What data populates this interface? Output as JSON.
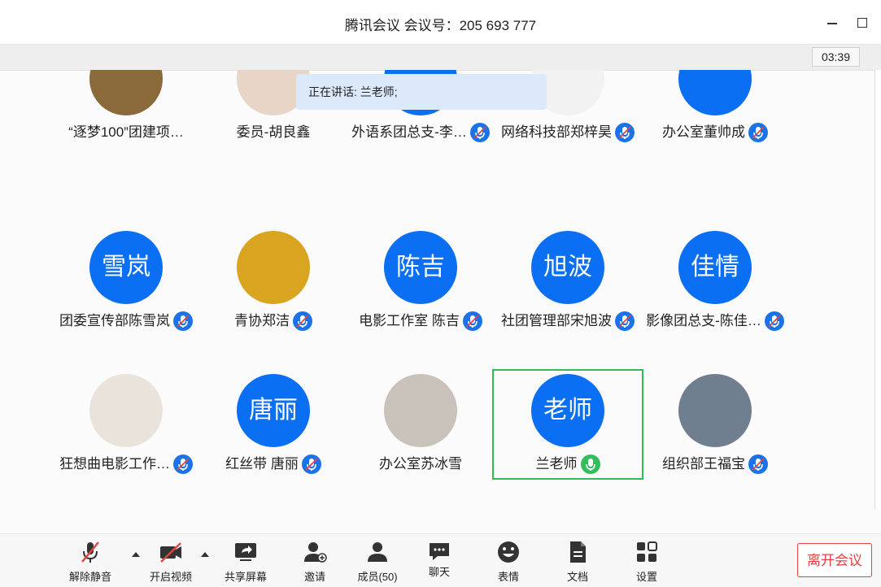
{
  "window": {
    "title": "腾讯会议 会议号：205 693 777"
  },
  "timer": "03:39",
  "speaking": "正在讲话: 兰老师;",
  "colors": {
    "avatar_blue": "#0a6ff2",
    "mic_blue": "#1a73e8",
    "active_green": "#2ebd59",
    "leave_red": "#e64242"
  },
  "rows": [
    [
      {
        "name": "“逐梦100”团建项…",
        "initials": "",
        "photo": true,
        "photo_tone": "#8a6a3a",
        "mic": "none"
      },
      {
        "name": "委员-胡良鑫",
        "initials": "",
        "photo": true,
        "photo_tone": "#e8d5c8",
        "mic": "none"
      },
      {
        "name": "外语系团总支-李…",
        "initials": "",
        "photo": false,
        "mic": "muted"
      },
      {
        "name": "网络科技部郑梓昊",
        "initials": "",
        "photo": true,
        "photo_tone": "#f2f2f2",
        "mic": "muted"
      },
      {
        "name": "办公室董帅成",
        "initials": "",
        "photo": false,
        "mic": "muted"
      }
    ],
    [
      {
        "name": "团委宣传部陈雪岚",
        "initials": "雪岚",
        "photo": false,
        "mic": "muted"
      },
      {
        "name": "青协郑洁",
        "initials": "",
        "photo": true,
        "photo_tone": "#d9a520",
        "mic": "muted"
      },
      {
        "name": "电影工作室 陈吉",
        "initials": "陈吉",
        "photo": false,
        "mic": "muted"
      },
      {
        "name": "社团管理部宋旭波",
        "initials": "旭波",
        "photo": false,
        "mic": "muted"
      },
      {
        "name": "影像团总支-陈佳…",
        "initials": "佳情",
        "photo": false,
        "mic": "muted"
      }
    ],
    [
      {
        "name": "狂想曲电影工作…",
        "initials": "",
        "photo": true,
        "photo_tone": "#e9e3dc",
        "mic": "muted"
      },
      {
        "name": "红丝带 唐丽",
        "initials": "唐丽",
        "photo": false,
        "mic": "muted"
      },
      {
        "name": "办公室苏冰雪",
        "initials": "",
        "photo": true,
        "photo_tone": "#c8c2bb",
        "mic": "none"
      },
      {
        "name": "兰老师",
        "initials": "老师",
        "photo": false,
        "mic": "on",
        "active": true
      },
      {
        "name": "组织部王福宝",
        "initials": "",
        "photo": true,
        "photo_tone": "#6f7f8f",
        "mic": "muted"
      }
    ]
  ],
  "toolbar": {
    "unmute": "解除静音",
    "video": "开启视频",
    "share": "共享屏幕",
    "invite": "邀请",
    "members": "成员(50)",
    "chat": "聊天",
    "emoji": "表情",
    "docs": "文档",
    "settings": "设置",
    "leave": "离开会议"
  }
}
